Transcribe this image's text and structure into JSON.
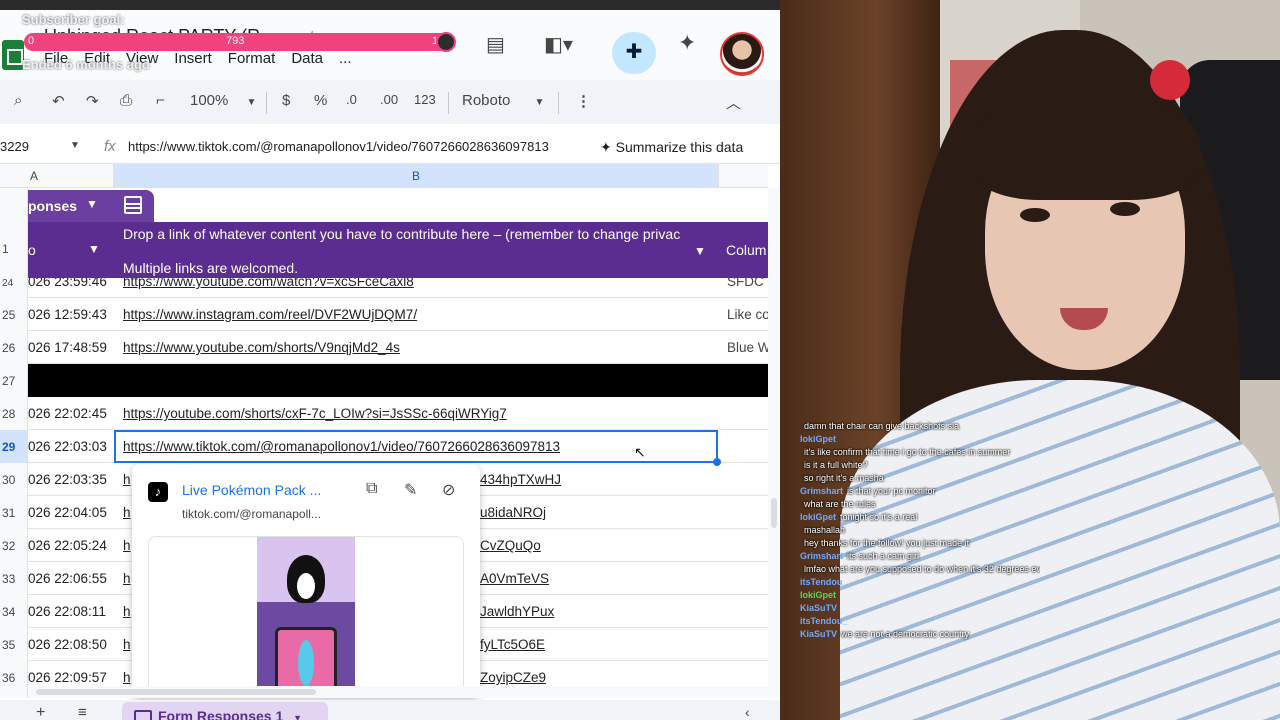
{
  "app": {
    "doc_title": "Unhinged React PARTY (R...",
    "menus": [
      "File",
      "Edit",
      "View",
      "Insert",
      "Format",
      "Data",
      "..."
    ]
  },
  "overlay": {
    "label": "Subscriber goal:",
    "min": "0",
    "current": "793",
    "max": "10",
    "ended": "Ended 6 months ago",
    "color": "#f0427d"
  },
  "toolbar": {
    "zoom": "100%",
    "currency": "$",
    "percent": "%",
    "dec_less": ".0",
    "dec_more": ".00",
    "number_fmt": "123",
    "font": "Roboto"
  },
  "formula_bar": {
    "cell_ref": "3229",
    "value": "https://www.tiktok.com/@romanapollonov1/video/7607266028636097813",
    "summarize_label": "Summarize this data"
  },
  "grid": {
    "col_a": "A",
    "col_b": "B",
    "table_name": "ponses",
    "header_row_num": "1",
    "header_a": "o",
    "header_b_line1": "Drop a link of whatever content you have to contribute here – (remember to change privac",
    "header_b_line2": "Multiple links are welcomed.",
    "header_c": "Colum",
    "rows": [
      {
        "num": "24",
        "ts": "026 23:59:46",
        "link": "https://www.youtube.com/watch?v=xcSFceCaxl8",
        "c": "SFDC"
      },
      {
        "num": "25",
        "ts": "026 12:59:43",
        "link": "https://www.instagram.com/reel/DVF2WUjDQM7/",
        "c": "Like co"
      },
      {
        "num": "26",
        "ts": "026 17:48:59",
        "link": "https://www.youtube.com/shorts/V9nqjMd2_4s",
        "c": "Blue W"
      },
      {
        "num": "27",
        "ts": "",
        "link": "",
        "c": ""
      },
      {
        "num": "28",
        "ts": "026 22:02:45",
        "link": "https://youtube.com/shorts/cxF-7c_LOIw?si=JsSSc-66qiWRYig7",
        "c": ""
      },
      {
        "num": "29",
        "ts": "026 22:03:03",
        "link": "https://www.tiktok.com/@romanapollonov1/video/7607266028636097813",
        "c": ""
      },
      {
        "num": "30",
        "ts": "026 22:03:35",
        "link": "h",
        "c": "",
        "tail": "434hpTXwHJ"
      },
      {
        "num": "31",
        "ts": "026 22:04:05",
        "link": "h",
        "c": "",
        "tail": "u8idaNROj"
      },
      {
        "num": "32",
        "ts": "026 22:05:24",
        "link": "h",
        "c": "",
        "tail": "CvZQuQo"
      },
      {
        "num": "33",
        "ts": "026 22:06:55",
        "link": "h",
        "c": "",
        "tail": "A0VmTeVS"
      },
      {
        "num": "34",
        "ts": "026 22:08:11",
        "link": "h",
        "c": "",
        "tail": "JawldhYPux"
      },
      {
        "num": "35",
        "ts": "026 22:08:50",
        "link": "h",
        "c": "",
        "tail": "fyLTc5O6E"
      },
      {
        "num": "36",
        "ts": "026 22:09:57",
        "link": "h",
        "c": "",
        "tail": "ZoyipCZe9"
      }
    ]
  },
  "preview": {
    "title": "Live Pokémon Pack ...",
    "url": "tiktok.com/@romanapoll..."
  },
  "bottom": {
    "sheet_tab": "Form Responses 1"
  },
  "chat": [
    {
      "user": "",
      "msg": "damn that chair can give backshots sia",
      "color": "#5ad45a"
    },
    {
      "user": "lokiGpet",
      "msg": "",
      "color": "#6fa8ff"
    },
    {
      "user": "",
      "msg": "it's like confirm that time i go to the cafes in summer",
      "color": "#ff9a3c"
    },
    {
      "user": "",
      "msg": "is it a full white?",
      "color": "#5ad45a"
    },
    {
      "user": "",
      "msg": "so right it's a masha",
      "color": "#d66bff"
    },
    {
      "user": "Grimshart",
      "msg": "is that your pc monitor",
      "color": "#6fa8ff"
    },
    {
      "user": "",
      "msg": "what are the rules",
      "color": "#5ad45a"
    },
    {
      "user": "lokiGpet",
      "msg": "tonight so it's a real",
      "color": "#6fa8ff"
    },
    {
      "user": "",
      "msg": "mashallah",
      "color": "#d66bff"
    },
    {
      "user": "",
      "msg": "hey thanks for the follow! you just made it",
      "color": "#6fa8ff"
    },
    {
      "user": "Grimshart",
      "msg": "its such a cam girl",
      "color": "#6fa8ff"
    },
    {
      "user": "",
      "msg": "lmfao what are you supposed to do when it's 32 degrees everyday",
      "color": "#ff5a9e"
    },
    {
      "user": "itsTendou",
      "msg": "",
      "color": "#6fa8ff"
    },
    {
      "user": "lokiGpet",
      "msg": "",
      "color": "#5ad45a"
    },
    {
      "user": "KiaSuTV",
      "msg": "",
      "color": "#6fa8ff"
    },
    {
      "user": "itsTendou_",
      "msg": "",
      "color": "#6fa8ff"
    },
    {
      "user": "KiaSuTV",
      "msg": "we are not a democratic country",
      "color": "#6fa8ff"
    }
  ]
}
